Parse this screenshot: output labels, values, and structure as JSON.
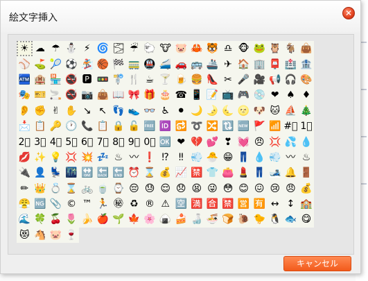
{
  "dialog": {
    "title": "絵文字挿入",
    "close_glyph": "✕",
    "cancel_label": "キャンセル"
  },
  "emoji_rows": [
    [
      "☀",
      "☁",
      "☂",
      "⛄",
      "⚡",
      "🌀",
      "🌫",
      "☔",
      "🐑",
      "🐮",
      "🐷",
      "🦀",
      "🐯",
      "♎",
      "🐵",
      "🐸",
      "🦉",
      "🐐",
      "👜"
    ],
    [
      "⚾",
      "⛳",
      "🎾",
      "⚽",
      "🏂",
      "🏀",
      "🏁",
      "🚃",
      "🚇",
      "🚄",
      "🚗",
      "🚌",
      "🚢",
      "✈",
      "🏠",
      "🏢",
      "📮",
      "🏥",
      "🏦"
    ],
    [
      "🏧",
      "🏨",
      "🏪",
      "🚭",
      "🅿",
      "🚥",
      "🚏",
      "🍴",
      "☕",
      "🍸",
      "🍺",
      "🍔",
      "👠",
      "✂",
      "🎤",
      "🎥",
      "📢",
      "🎧",
      "🎨"
    ],
    [
      "🎭",
      "🎫",
      "🚬",
      "🚭",
      "📷",
      "👜",
      "📖",
      "🎀",
      "🎁",
      "🎂",
      "☎",
      "📱",
      "📝",
      "📺",
      "🎮",
      "💿",
      "❤",
      "♠",
      "♦"
    ],
    [
      "👂",
      "✊",
      "✌",
      "✋",
      "↘",
      "↖",
      "👣",
      "👟",
      "👓",
      "♿",
      "⚫",
      "🌙",
      "🌛",
      "🌜",
      "🌝",
      "🐶",
      "🐱",
      "⛵",
      "🎄"
    ],
    [
      "📩",
      "📋",
      "🔑",
      "🕐",
      "📞",
      "📋",
      "🔒",
      "🔓",
      "🆓",
      "🆔",
      "🔂",
      "➰",
      "🔀",
      "🔃",
      "🆕",
      "🚩",
      "📶",
      "#⃣",
      "1⃣"
    ],
    [
      "2⃣",
      "3⃣",
      "4⃣",
      "5⃣",
      "6⃣",
      "7⃣",
      "8⃣",
      "9⃣",
      "0⃣",
      "🆗",
      "❤",
      "💔",
      "💕",
      "❣",
      "💓",
      "😠",
      "💢",
      "💦",
      "💧"
    ],
    [
      "💋",
      "✨",
      "💡",
      "💢",
      "💥",
      "💤",
      "♨",
      "〰",
      "❗",
      "⁉",
      "‼",
      "💨",
      "🐣",
      "😁",
      "👖",
      "💧",
      "💨",
      "〰",
      "♨"
    ],
    [
      "🔌",
      "👤",
      "💺",
      "🌃",
      "🔛",
      "🔙",
      "🔚",
      "⏰",
      "⌛",
      "💰",
      "📈",
      "🈲",
      "👕",
      "👛",
      "💄",
      "👖",
      "🎿",
      "🔔",
      "🚪"
    ],
    [
      "✏",
      "👑",
      "💍",
      "⌛",
      "🚲",
      "🍵",
      "⌚",
      "😔",
      "😓",
      "😌",
      "😞",
      "😫",
      "😜",
      "😳",
      "😊",
      "😖",
      "😢",
      "😠",
      "💰"
    ],
    [
      "😤",
      "🆖",
      "📎",
      "©",
      "™",
      "🏃",
      "㊙",
      "♻",
      "®",
      "⚠",
      "🈳",
      "🈵",
      "🈴",
      "🈲",
      "🈺",
      "🈶",
      "↔",
      "↕",
      "🏫"
    ],
    [
      "🌊",
      "🍀",
      "🍒",
      "🌷",
      "🍌",
      "🍎",
      "🌱",
      "🍁",
      "🌸",
      "🍙",
      "🍰",
      "🍶",
      "🍜",
      "🍞",
      "🐌",
      "🐤",
      "🐧",
      "🐟",
      "😋"
    ],
    [
      "😻",
      "🐴",
      "🐷",
      "🍷"
    ]
  ],
  "selected_index": 0
}
